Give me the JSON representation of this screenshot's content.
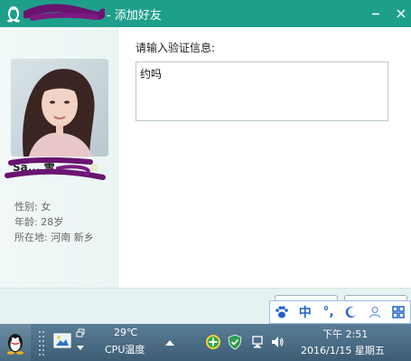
{
  "window": {
    "title": "- 添加好友",
    "min_icon": "minimize-icon",
    "close_icon": "close-icon"
  },
  "profile": {
    "name": "Sa... 雪",
    "gender_label": "性别: 女",
    "age_label": "年龄: 28岁",
    "location_label": "所在地: 河南  新乡"
  },
  "form": {
    "verify_label": "请输入验证信息:",
    "verify_value": "约吗"
  },
  "ime": {
    "items": [
      "paw-icon",
      "中",
      "°,",
      "moon-icon",
      "user-icon",
      "grid-icon"
    ],
    "chinese_label": "中",
    "punct_label": "°,"
  },
  "taskbar": {
    "temperature": "29℃",
    "cpu_label": "CPU温度",
    "time": "下午 2:51",
    "date": "2016/1/15 星期五"
  },
  "colors": {
    "title_bar": "#1e9f8b",
    "ime_blue": "#1f63c9",
    "taskbar": "#4a6b84"
  }
}
